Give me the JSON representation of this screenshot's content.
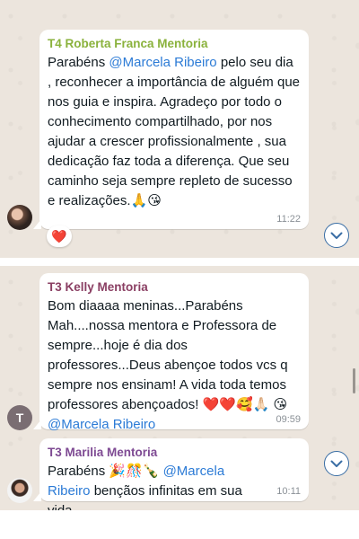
{
  "messages": [
    {
      "sender": "T4 Roberta Franca Mentoria",
      "sender_color": "#8ab23c",
      "text_before": "Parabéns ",
      "mention": "@Marcela Ribeiro",
      "text_after": "  pelo seu dia , reconhecer a importância de alguém que nos guia e inspira. Agradeço por todo o conhecimento compartilhado, por nos ajudar a crescer profissionalmente , sua dedicação  faz toda a diferença. Que seu caminho seja sempre repleto de sucesso e realizações.🙏😘",
      "time": "11:22",
      "reaction": "❤️"
    },
    {
      "sender": "T3 Kelly Mentoria",
      "sender_color": "#8a3f63",
      "text_before": "Bom diaaaa meninas...Parabéns Mah....nossa mentora e Professora de sempre...hoje é dia dos professores...Deus abençoe todos vcs q sempre nos ensinam! A vida toda temos professores abençoados! ❤️❤️🥰🙏🏻 😘 ",
      "mention": "@Marcela Ribeiro",
      "text_after": "",
      "time": "09:59",
      "avatar_letter": "T"
    },
    {
      "sender": "T3 Marilia Mentoria",
      "sender_color": "#7e4a93",
      "text_before": "Parabéns 🎉🎊🍾 ",
      "mention": "@Marcela Ribeiro",
      "text_after": " bençãos infinitas em sua vida",
      "time": "10:11"
    }
  ],
  "icons": {
    "scroll_down": "chevron-down-icon",
    "reaction": "heart-icon"
  }
}
